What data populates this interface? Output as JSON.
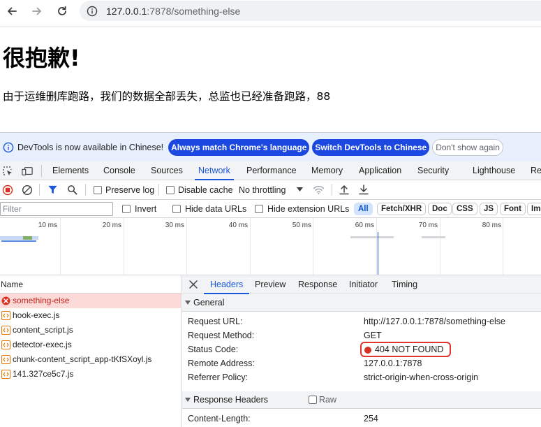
{
  "browser": {
    "url_host": "127.0.0.1",
    "url_path": ":7878/something-else"
  },
  "page": {
    "title": "很抱歉!",
    "message": "由于运维删库跑路，我们的数据全部丢失，总监也已经准备跑路，88"
  },
  "devtools": {
    "infobar": {
      "message": "DevTools is now available in Chinese!",
      "match_language": "Always match Chrome's language",
      "switch_chinese": "Switch DevTools to Chinese",
      "dont_show": "Don't show again"
    },
    "tabs": [
      "Elements",
      "Console",
      "Sources",
      "Network",
      "Performance",
      "Memory",
      "Application",
      "Security",
      "Lighthouse",
      "Re"
    ],
    "active_tab": "Network",
    "network_toolbar": {
      "preserve_log": "Preserve log",
      "disable_cache": "Disable cache",
      "throttling": "No throttling"
    },
    "filter": {
      "placeholder": "Filter",
      "invert": "Invert",
      "hide_data_urls": "Hide data URLs",
      "hide_extension_urls": "Hide extension URLs",
      "types": [
        "All",
        "Fetch/XHR",
        "Doc",
        "CSS",
        "JS",
        "Font",
        "Img"
      ]
    },
    "overview_ticks": [
      "10 ms",
      "20 ms",
      "30 ms",
      "40 ms",
      "50 ms",
      "60 ms",
      "70 ms",
      "80 ms"
    ],
    "requests": {
      "header": "Name",
      "items": [
        {
          "name": "something-else",
          "status": "error"
        },
        {
          "name": "hook-exec.js",
          "status": "ok"
        },
        {
          "name": "content_script.js",
          "status": "ok"
        },
        {
          "name": "detector-exec.js",
          "status": "ok"
        },
        {
          "name": "chunk-content_script_app-tKfSXoyl.js",
          "status": "ok"
        },
        {
          "name": "141.327ce5c7.js",
          "status": "ok"
        }
      ]
    },
    "details": {
      "tabs": [
        "Headers",
        "Preview",
        "Response",
        "Initiator",
        "Timing"
      ],
      "active_tab": "Headers",
      "general_title": "General",
      "general": [
        {
          "key": "Request URL:",
          "value": "http://127.0.0.1:7878/something-else"
        },
        {
          "key": "Request Method:",
          "value": "GET"
        },
        {
          "key": "Status Code:",
          "value": "404 NOT FOUND"
        },
        {
          "key": "Remote Address:",
          "value": "127.0.0.1:7878"
        },
        {
          "key": "Referrer Policy:",
          "value": "strict-origin-when-cross-origin"
        }
      ],
      "response_headers_title": "Response Headers",
      "raw_label": "Raw",
      "response_headers": [
        {
          "key": "Content-Length:",
          "value": "254"
        }
      ]
    }
  },
  "colors": {
    "accent": "#1a56db",
    "error": "#d93025",
    "error_row_bg": "#fbdad7"
  }
}
